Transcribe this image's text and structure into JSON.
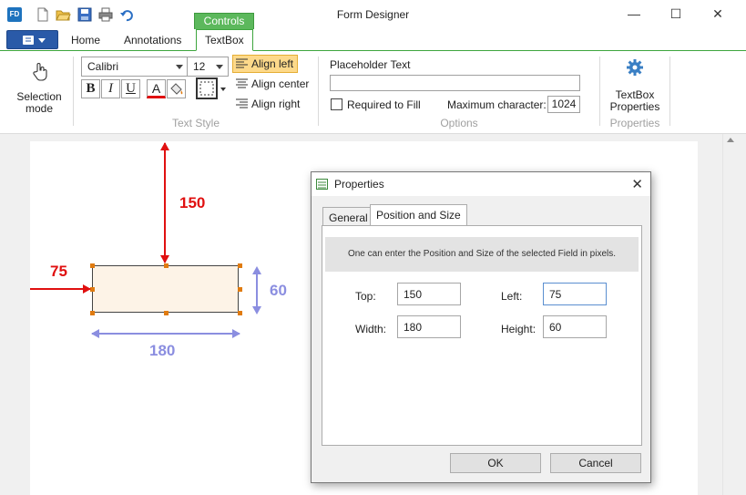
{
  "window": {
    "title": "Form Designer",
    "app_icon_text": "FD",
    "controls_label": "Controls",
    "minimize_glyph": "—",
    "maximize_glyph": "☐",
    "close_glyph": "✕"
  },
  "quick_access": [
    "new-document-icon",
    "open-folder-icon",
    "save-icon",
    "print-icon",
    "undo-icon"
  ],
  "ribbon": {
    "tabs": [
      {
        "label": "Home"
      },
      {
        "label": "Annotations"
      },
      {
        "label": "TextBox"
      }
    ],
    "active_tab": "TextBox",
    "selection_mode": {
      "label_line1": "Selection",
      "label_line2": "mode"
    },
    "text_style": {
      "font": "Calibri",
      "size": "12",
      "bold_glyph": "B",
      "italic_glyph": "I",
      "underline_glyph": "U",
      "fontcolor_glyph": "A",
      "align_left": "Align left",
      "align_center": "Align center",
      "align_right": "Align right",
      "group_label": "Text Style"
    },
    "options": {
      "placeholder_label": "Placeholder Text",
      "placeholder_value": "",
      "required_label": "Required to Fill",
      "required_checked": false,
      "max_char_label": "Maximum character:",
      "max_char_value": "1024",
      "group_label": "Options"
    },
    "properties": {
      "button_line1": "TextBox",
      "button_line2": "Properties",
      "group_label": "Properties"
    },
    "colors": {
      "accent_green": "#3da53d",
      "active_align": "#fdd98a"
    }
  },
  "canvas": {
    "dim_top": "150",
    "dim_left": "75",
    "dim_width": "180",
    "dim_height": "60",
    "colors": {
      "red": "#e01010",
      "blue": "#8b8ee0",
      "field_fill": "#fdf3e7",
      "handle": "#e07b10"
    }
  },
  "dialog": {
    "title": "Properties",
    "tabs": [
      {
        "label": "General"
      },
      {
        "label": "Position and Size"
      }
    ],
    "active_tab": "Position and Size",
    "info": "One can enter the Position and Size of the selected Field in pixels.",
    "fields": {
      "top_label": "Top:",
      "top_value": "150",
      "left_label": "Left:",
      "left_value": "75",
      "width_label": "Width:",
      "width_value": "180",
      "height_label": "Height:",
      "height_value": "60"
    },
    "ok": "OK",
    "cancel": "Cancel"
  }
}
